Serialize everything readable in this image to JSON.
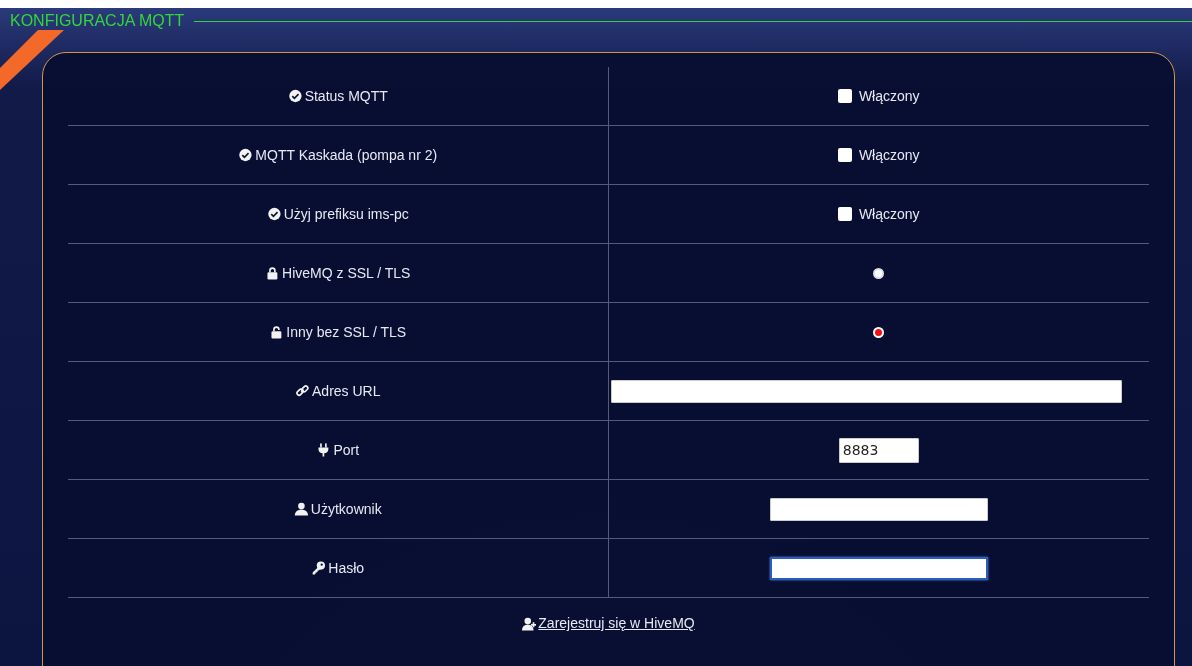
{
  "section": {
    "title": "KONFIGURACJA MQTT"
  },
  "rows": [
    {
      "label": "Status MQTT",
      "kind": "checkbox",
      "option": "Włączony",
      "checked": false
    },
    {
      "label": "MQTT Kaskada (pompa nr 2)",
      "kind": "checkbox",
      "option": "Włączony",
      "checked": false
    },
    {
      "label": "Użyj prefiksu ims-pc",
      "kind": "checkbox",
      "option": "Włączony",
      "checked": false
    },
    {
      "label": "HiveMQ z SSL / TLS",
      "kind": "radio",
      "selected": false
    },
    {
      "label": "Inny bez SSL / TLS",
      "kind": "radio",
      "selected": true
    },
    {
      "label": "Adres URL",
      "kind": "input",
      "focused": false
    },
    {
      "label": "Port",
      "kind": "input",
      "value": "8883",
      "focused": false
    },
    {
      "label": "Użytkownik",
      "kind": "input",
      "focused": false
    },
    {
      "label": "Hasło",
      "kind": "input",
      "focused": true
    }
  ],
  "register_link": {
    "text": "Zarejestruj się w HiveMQ"
  }
}
